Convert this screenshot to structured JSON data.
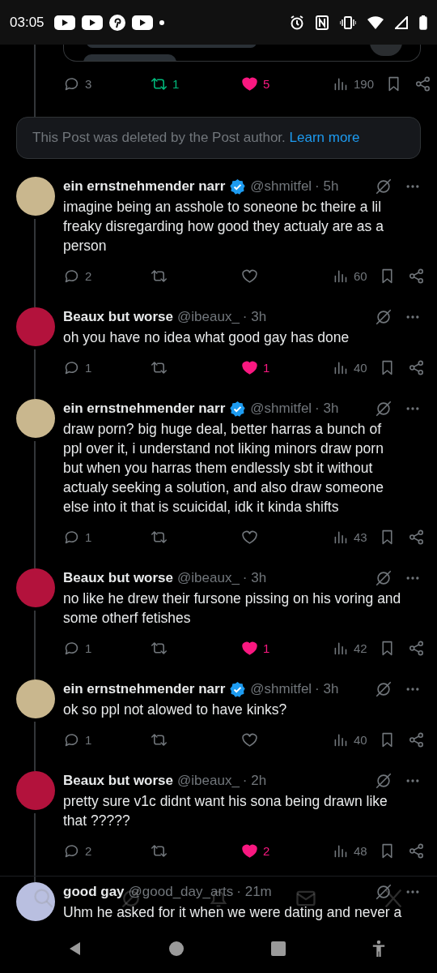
{
  "status_bar": {
    "time": "03:05"
  },
  "top_post": {
    "replies": "3",
    "retweeted": true,
    "retweets": "1",
    "liked": true,
    "likes": "5",
    "views": "190"
  },
  "deleted_notice": {
    "text": "This Post was deleted by the Post author.",
    "link": "Learn more"
  },
  "replies": [
    {
      "name": "ein ernstnehmender narr",
      "verified": true,
      "handle": "@shmitfel",
      "time": "· 5h",
      "avatar": {
        "color": "#c9b78e"
      },
      "text": "imagine being an asshole to soneone bc theire a lil freaky disregarding how good they actualy are as a person",
      "replies": "2",
      "retweeted": false,
      "liked": false,
      "views": "60"
    },
    {
      "name": "Beaux but worse",
      "verified": false,
      "handle": "@ibeaux_",
      "time": "· 3h",
      "avatar": {
        "color": "#b3123c"
      },
      "text": "oh you have no idea what good gay has done",
      "replies": "1",
      "retweeted": false,
      "liked": true,
      "likes": "1",
      "views": "40"
    },
    {
      "name": "ein ernstnehmender narr",
      "verified": true,
      "handle": "@shmitfel",
      "time": "· 3h",
      "avatar": {
        "color": "#c9b78e"
      },
      "text": "draw porn? big huge deal, better harras a bunch of ppl over it, i understand not liking minors draw porn but when you harras them endlessly sbt it without actualy seeking a solution, and also draw someone else into it that is scuicidal, idk it kinda shifts",
      "replies": "1",
      "retweeted": false,
      "liked": false,
      "views": "43"
    },
    {
      "name": "Beaux but worse",
      "verified": false,
      "handle": "@ibeaux_",
      "time": "· 3h",
      "avatar": {
        "color": "#b3123c"
      },
      "text": "no like he drew their fursone pissing on his voring and some otherf fetishes",
      "replies": "1",
      "retweeted": false,
      "liked": true,
      "likes": "1",
      "views": "42"
    },
    {
      "name": "ein ernstnehmender narr",
      "verified": true,
      "handle": "@shmitfel",
      "time": "· 3h",
      "avatar": {
        "color": "#c9b78e"
      },
      "text": "ok so ppl not alowed to have kinks?",
      "replies": "1",
      "retweeted": false,
      "liked": false,
      "views": "40"
    },
    {
      "name": "Beaux but worse",
      "verified": false,
      "handle": "@ibeaux_",
      "time": "· 2h",
      "avatar": {
        "color": "#b3123c"
      },
      "text": "pretty sure v1c didnt want his sona being drawn like that ?????",
      "replies": "2",
      "retweeted": false,
      "liked": true,
      "likes": "2",
      "views": "48"
    },
    {
      "name": "good gay",
      "verified": false,
      "handle": "@good_day_arts",
      "time": "· 21m",
      "avatar": {
        "color": "#b9bfe0"
      },
      "text": "Uhm he asked for it when we were dating and never a"
    }
  ]
}
